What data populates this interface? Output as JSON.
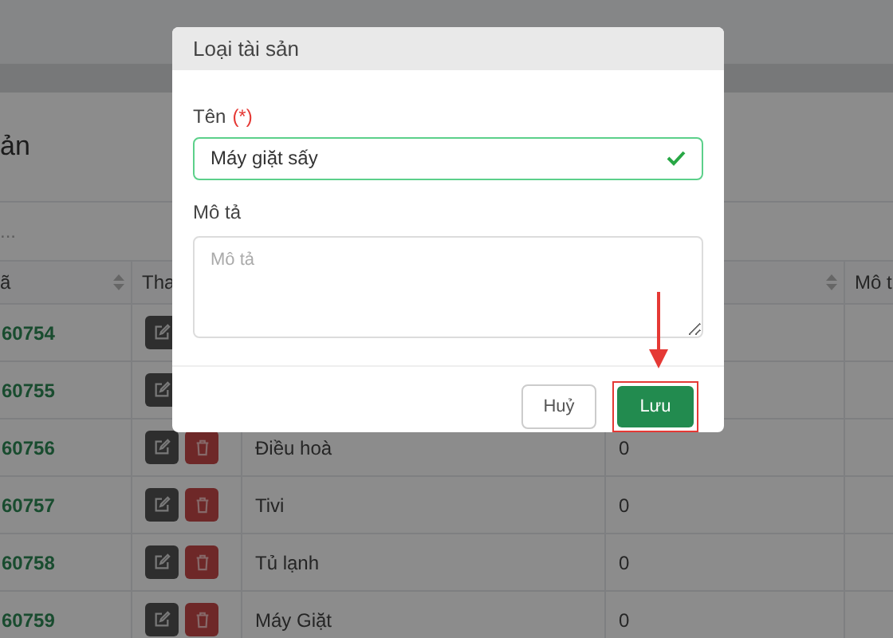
{
  "page": {
    "title": "ản",
    "search_placeholder": "..."
  },
  "table": {
    "columns": [
      {
        "label": "ã",
        "sortable": true
      },
      {
        "label": "Tha",
        "sortable": false
      },
      {},
      {
        "sortable": true
      },
      {
        "label": "Mô t",
        "sortable": false
      }
    ],
    "rows": [
      {
        "code": "60754"
      },
      {
        "code": "60755"
      },
      {
        "code": "60756",
        "name": "Điều hoà",
        "count": "0"
      },
      {
        "code": "60757",
        "name": "Tivi",
        "count": "0"
      },
      {
        "code": "60758",
        "name": "Tủ lạnh",
        "count": "0"
      },
      {
        "code": "60759",
        "name": "Máy Giặt",
        "count": "0"
      }
    ]
  },
  "dialog": {
    "title": "Loại tài sản",
    "name_label": "Tên",
    "required_mark": "(*)",
    "name_value": "Máy giặt sấy",
    "name_valid": true,
    "description_label": "Mô tả",
    "description_placeholder": "Mô tả",
    "buttons": [
      {
        "label": "Huỷ",
        "kind": "cancel",
        "highlighted": false
      },
      {
        "label": "Lưu",
        "kind": "save",
        "highlighted": true
      }
    ]
  }
}
